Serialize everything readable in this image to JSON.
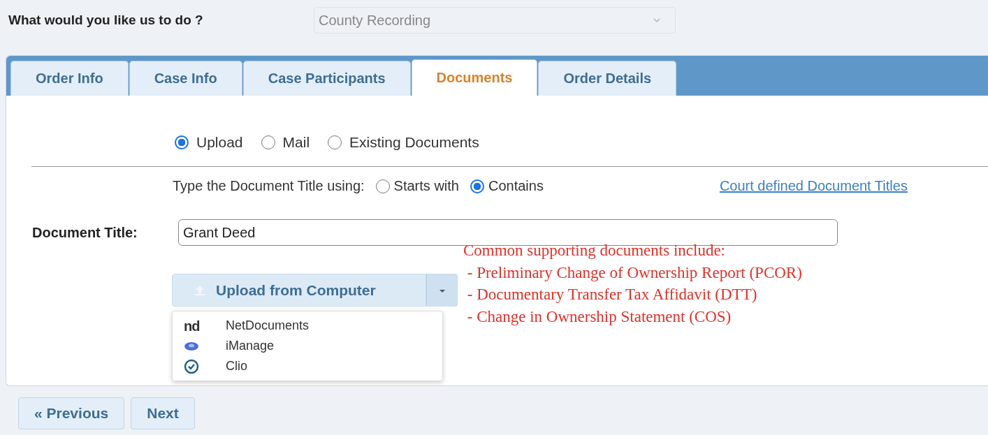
{
  "question": {
    "label": "What would you like us to do ?",
    "value": "County Recording",
    "disabled": true
  },
  "tabs": [
    {
      "label": "Order Info",
      "selected": false
    },
    {
      "label": "Case Info",
      "selected": false
    },
    {
      "label": "Case Participants",
      "selected": false
    },
    {
      "label": "Documents",
      "selected": true
    },
    {
      "label": "Order Details",
      "selected": false
    }
  ],
  "delivery_options": [
    {
      "label": "Upload",
      "selected": true
    },
    {
      "label": "Mail",
      "selected": false
    },
    {
      "label": "Existing Documents",
      "selected": false
    }
  ],
  "search_mode": {
    "label": "Type the Document Title using:",
    "options": [
      {
        "label": "Starts with",
        "selected": false
      },
      {
        "label": "Contains",
        "selected": true
      }
    ],
    "link": "Court defined Document Titles"
  },
  "document_title": {
    "label": "Document Title:",
    "value": "Grant Deed"
  },
  "upload_button": {
    "label": "Upload from Computer",
    "expanded": true
  },
  "upload_menu": [
    {
      "label": "NetDocuments",
      "kind": "letters",
      "logo_text": "nd"
    },
    {
      "label": "iManage",
      "kind": "bubble"
    },
    {
      "label": "Clio",
      "kind": "check-circle"
    }
  ],
  "annotation": [
    "Common supporting documents include:",
    " - Preliminary Change of Ownership Report (PCOR)",
    " - Documentary Transfer Tax Affidavit (DTT)",
    " - Change in Ownership Statement (COS)"
  ],
  "nav_buttons": [
    "« Previous",
    "Next"
  ]
}
